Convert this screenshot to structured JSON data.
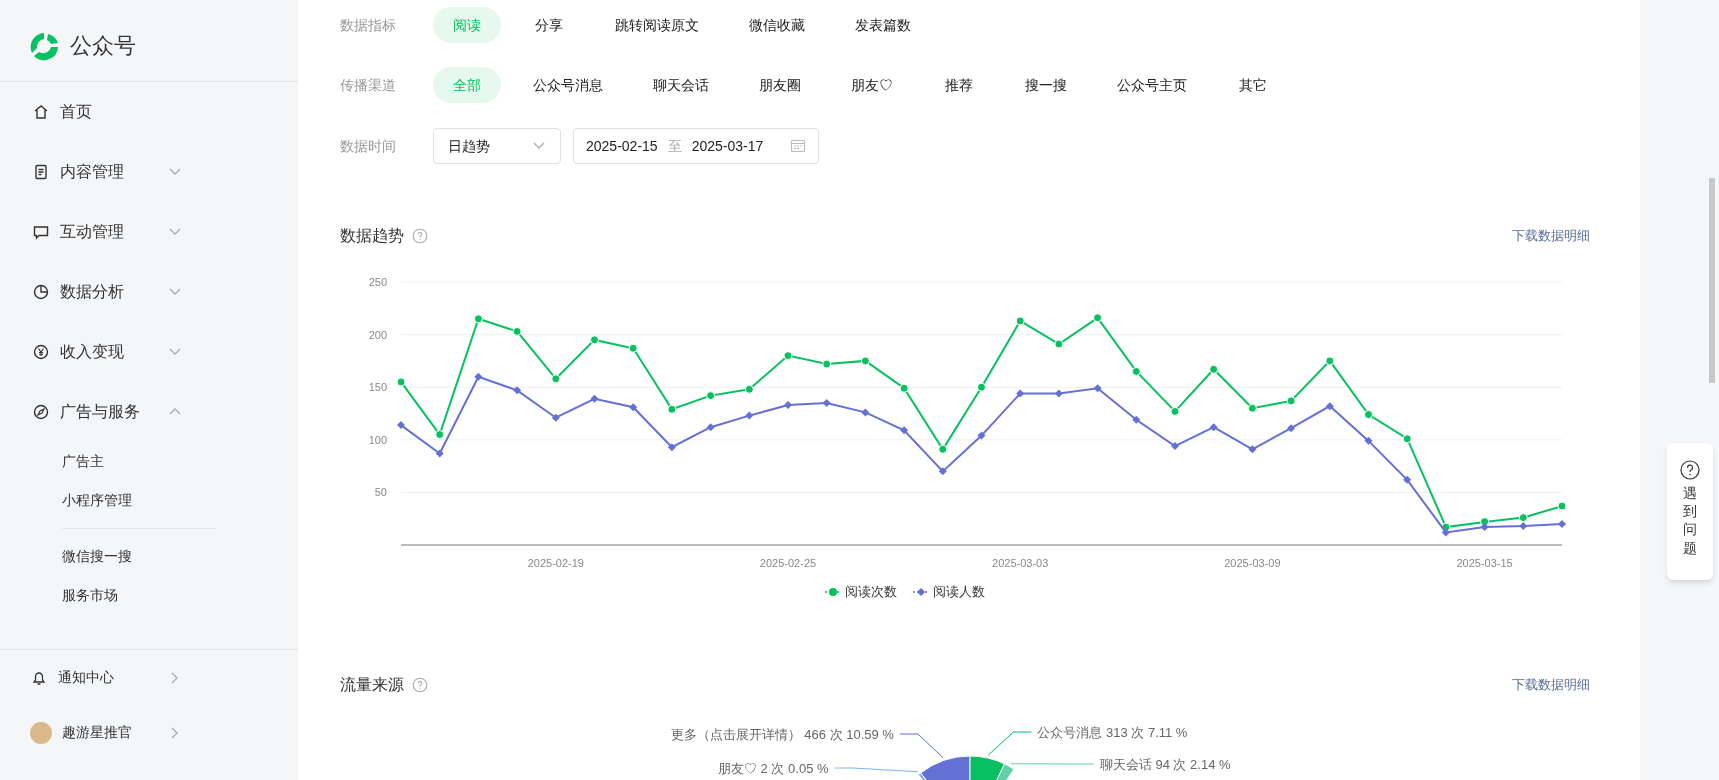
{
  "sidebar": {
    "logo_text": "公众号",
    "items": [
      {
        "label": "首页",
        "kind": "link"
      },
      {
        "label": "内容管理",
        "kind": "group",
        "expanded": false
      },
      {
        "label": "互动管理",
        "kind": "group",
        "expanded": false
      },
      {
        "label": "数据分析",
        "kind": "group",
        "expanded": false
      },
      {
        "label": "收入变现",
        "kind": "group",
        "expanded": false
      },
      {
        "label": "广告与服务",
        "kind": "group",
        "expanded": true,
        "children": [
          {
            "label": "广告主"
          },
          {
            "label": "小程序管理"
          },
          {
            "label": "微信搜一搜"
          },
          {
            "label": "服务市场"
          }
        ]
      }
    ],
    "footer": [
      {
        "label": "通知中心",
        "kind": "bell"
      },
      {
        "label": "趣游星推官",
        "kind": "avatar"
      }
    ]
  },
  "filters": [
    {
      "label": "数据指标",
      "options": [
        {
          "label": "阅读",
          "selected": true
        },
        {
          "label": "分享",
          "selected": false
        },
        {
          "label": "跳转阅读原文",
          "selected": false
        },
        {
          "label": "微信收藏",
          "selected": false
        },
        {
          "label": "发表篇数",
          "selected": false
        }
      ]
    },
    {
      "label": "传播渠道",
      "options": [
        {
          "label": "全部",
          "selected": true
        },
        {
          "label": "公众号消息",
          "selected": false
        },
        {
          "label": "聊天会话",
          "selected": false
        },
        {
          "label": "朋友圈",
          "selected": false
        },
        {
          "label": "朋友♡",
          "selected": false
        },
        {
          "label": "推荐",
          "selected": false
        },
        {
          "label": "搜一搜",
          "selected": false
        },
        {
          "label": "公众号主页",
          "selected": false
        },
        {
          "label": "其它",
          "selected": false
        }
      ]
    }
  ],
  "time": {
    "label": "数据时间",
    "mode": "日趋势",
    "start": "2025-02-15",
    "separator": "至",
    "end": "2025-03-17"
  },
  "trend": {
    "title": "数据趋势",
    "download": "下载数据明细",
    "chart_data": {
      "type": "line",
      "grid": true,
      "x": [
        "2025-02-15",
        "2025-02-16",
        "2025-02-17",
        "2025-02-18",
        "2025-02-19",
        "2025-02-20",
        "2025-02-21",
        "2025-02-22",
        "2025-02-23",
        "2025-02-24",
        "2025-02-25",
        "2025-02-26",
        "2025-02-27",
        "2025-02-28",
        "2025-03-01",
        "2025-03-02",
        "2025-03-03",
        "2025-03-04",
        "2025-03-05",
        "2025-03-06",
        "2025-03-07",
        "2025-03-08",
        "2025-03-09",
        "2025-03-10",
        "2025-03-11",
        "2025-03-12",
        "2025-03-13",
        "2025-03-14",
        "2025-03-15",
        "2025-03-16",
        "2025-03-17"
      ],
      "xlim": [
        "2025-02-15",
        "2025-03-17"
      ],
      "xticks": [
        "2025-02-19",
        "2025-02-25",
        "2025-03-03",
        "2025-03-09",
        "2025-03-15"
      ],
      "ylim": [
        0,
        250
      ],
      "yticks": [
        50,
        100,
        150,
        200,
        250
      ],
      "series": [
        {
          "name": "阅读次数",
          "color": "#07c160",
          "marker": "circle",
          "values": [
            155,
            105,
            215,
            203,
            158,
            195,
            187,
            129,
            142,
            148,
            180,
            172,
            175,
            149,
            91,
            150,
            213,
            191,
            216,
            165,
            127,
            167,
            130,
            137,
            175,
            124,
            101,
            17,
            22,
            26,
            37
          ]
        },
        {
          "name": "阅读人数",
          "color": "#6470d4",
          "marker": "diamond",
          "values": [
            114,
            87,
            160,
            147,
            121,
            139,
            131,
            93,
            112,
            123,
            133,
            135,
            126,
            109,
            70,
            104,
            144,
            144,
            149,
            119,
            94,
            112,
            91,
            111,
            132,
            99,
            62,
            12,
            17,
            18,
            20
          ]
        }
      ]
    }
  },
  "traffic": {
    "title": "流量来源",
    "download": "下载数据明细",
    "labels": [
      {
        "text": "更多（点击展开详情） 466 次 10.59 %",
        "color": "#6470d4"
      },
      {
        "text": "朋友♡ 2 次 0.05 %",
        "color": "#7cb5ec"
      },
      {
        "text": "公众号消息 313 次 7.11 %",
        "color": "#07c160"
      },
      {
        "text": "聊天会话 94 次 2.14 %",
        "color": "#5fd0a8"
      }
    ]
  },
  "help": {
    "text": "遇到问题"
  }
}
